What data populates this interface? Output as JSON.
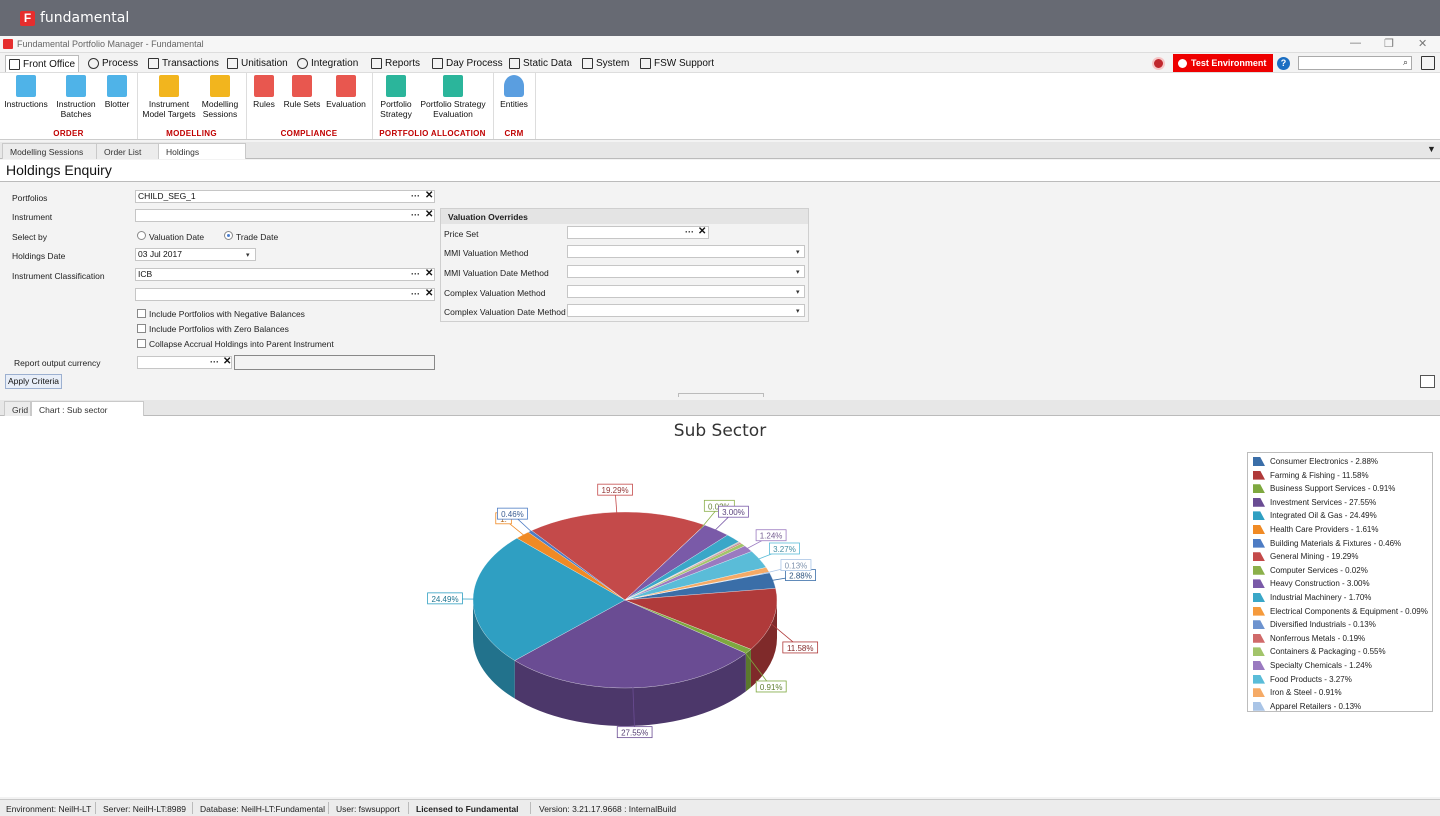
{
  "brand": {
    "logo_letter": "F",
    "name": "fundamental"
  },
  "window": {
    "title": "Fundamental Portfolio Manager - Fundamental",
    "minimize": "—",
    "restore": "❐",
    "close": "✕"
  },
  "menu": [
    {
      "label": "Front Office",
      "icon": "chart-icon"
    },
    {
      "label": "Process",
      "icon": "gear-icon"
    },
    {
      "label": "Transactions",
      "icon": "list-icon"
    },
    {
      "label": "Unitisation",
      "icon": "hierarchy-icon"
    },
    {
      "label": "Integration",
      "icon": "sync-icon"
    },
    {
      "label": "Reports",
      "icon": "report-icon"
    },
    {
      "label": "Day Process",
      "icon": "calendar-icon"
    },
    {
      "label": "Static Data",
      "icon": "database-icon"
    },
    {
      "label": "System",
      "icon": "server-icon"
    },
    {
      "label": "FSW Support",
      "icon": "support-icon"
    }
  ],
  "test_env": "Test Environment",
  "ribbon": {
    "buttons": [
      {
        "label1": "Instructions",
        "label2": "",
        "color": "#4fb3e8"
      },
      {
        "label1": "Instruction",
        "label2": "Batches",
        "color": "#4fb3e8"
      },
      {
        "label1": "Blotter",
        "label2": "",
        "color": "#4fb3e8"
      },
      {
        "label1": "Instrument",
        "label2": "Model Targets",
        "color": "#f2b51e"
      },
      {
        "label1": "Modelling",
        "label2": "Sessions",
        "color": "#f2b51e"
      },
      {
        "label1": "Rules",
        "label2": "",
        "color": "#e8574f"
      },
      {
        "label1": "Rule Sets",
        "label2": "",
        "color": "#e8574f"
      },
      {
        "label1": "Evaluation",
        "label2": "",
        "color": "#e8574f"
      },
      {
        "label1": "Portfolio",
        "label2": "Strategy",
        "color": "#2bb59b"
      },
      {
        "label1": "Portfolio Strategy",
        "label2": "Evaluation",
        "color": "#2bb59b"
      },
      {
        "label1": "Entities",
        "label2": "",
        "color": "#5a9ee0"
      }
    ],
    "groups": [
      "ORDER",
      "MODELLING",
      "COMPLIANCE",
      "PORTFOLIO ALLOCATION",
      "CRM"
    ]
  },
  "doc_tabs": [
    "Modelling Sessions",
    "Order List",
    "Holdings Enquiry"
  ],
  "page_title": "Holdings Enquiry",
  "form": {
    "portfolios_label": "Portfolios",
    "portfolios_value": "CHILD_SEG_1",
    "instrument_label": "Instrument",
    "instrument_value": "",
    "select_by_label": "Select by",
    "valuation_date": "Valuation Date",
    "trade_date": "Trade Date",
    "holdings_date_label": "Holdings Date",
    "holdings_date_value": "03 Jul 2017",
    "classification_label": "Instrument Classification",
    "classification_value": "ICB",
    "classification2_value": "",
    "chk_negative": "Include Portfolios with Negative Balances",
    "chk_zero": "Include Portfolios with Zero Balances",
    "chk_collapse": "Collapse Accrual Holdings into Parent Instrument",
    "report_currency_label": "Report output currency",
    "apply": "Apply Criteria",
    "ellipsis": "···",
    "clear": "✕",
    "dropdown": "▾"
  },
  "valuation_overrides": {
    "title": "Valuation Overrides",
    "price_set": "Price Set",
    "mmi_method": "MMI Valuation Method",
    "mmi_date_method": "MMI Valuation Date Method",
    "complex_method": "Complex Valuation Method",
    "complex_date_method": "Complex Valuation Date Method"
  },
  "sub_tabs": [
    "Grid",
    "Chart : Sub sector (Pie)"
  ],
  "chart_data": {
    "type": "pie",
    "title": "Sub Sector",
    "legend_position": "right",
    "categories": [
      "Consumer Electronics",
      "Farming & Fishing",
      "Business Support Services",
      "Investment Services",
      "Integrated Oil & Gas",
      "Health Care Providers",
      "Building Materials & Fixtures",
      "General Mining",
      "Computer Services",
      "Heavy Construction",
      "Industrial Machinery",
      "Electrical Components & Equipment",
      "Diversified Industrials",
      "Nonferrous Metals",
      "Containers & Packaging",
      "Specialty Chemicals",
      "Food Products",
      "Iron & Steel",
      "Apparel Retailers"
    ],
    "values": [
      2.88,
      11.58,
      0.91,
      27.55,
      24.49,
      1.61,
      0.46,
      19.29,
      0.02,
      3.0,
      1.7,
      0.09,
      0.13,
      0.19,
      0.55,
      1.24,
      3.27,
      0.91,
      0.13
    ],
    "legend_labels": [
      "Consumer Electronics - 2.88%",
      "Farming & Fishing - 11.58%",
      "Business Support Services - 0.91%",
      "Investment Services - 27.55%",
      "Integrated Oil & Gas - 24.49%",
      "Health Care Providers - 1.61%",
      "Building Materials & Fixtures - 0.46%",
      "General Mining - 19.29%",
      "Computer Services - 0.02%",
      "Heavy Construction - 3.00%",
      "Industrial Machinery - 1.70%",
      "Electrical Components & Equipment - 0.09%",
      "Diversified Industrials - 0.13%",
      "Nonferrous Metals - 0.19%",
      "Containers & Packaging - 0.55%",
      "Specialty Chemicals - 1.24%",
      "Food Products - 3.27%",
      "Iron & Steel - 0.91%",
      "Apparel Retailers - 0.13%"
    ],
    "data_labels": [
      "2.88%",
      "11.58%",
      "0.91%",
      "27.55%",
      "24.49%",
      "1.",
      "0.46%",
      "19.29%",
      "0.02%",
      "3.00%",
      "",
      "",
      "",
      "",
      "",
      "1.24%",
      "3.27%",
      "",
      "0.13%"
    ],
    "colors": [
      "#3a6ea8",
      "#b03a3a",
      "#7ea83f",
      "#6a4c93",
      "#2f9fc2",
      "#f08a24",
      "#4d7cc4",
      "#c44a4a",
      "#8bb04a",
      "#7a5aa8",
      "#3aa7c8",
      "#f59a3c",
      "#6d93cf",
      "#d06a6a",
      "#a2c46a",
      "#9a7ac0",
      "#5abcd8",
      "#f5aa66",
      "#a9c4e6"
    ]
  },
  "status": [
    "Environment: NeilH-LT",
    "Server: NeilH-LT:8989",
    "Database: NeilH-LT:Fundamental",
    "User: fswsupport",
    "Licensed to Fundamental",
    "Version: 3.21.17.9668 : InternalBuild"
  ]
}
